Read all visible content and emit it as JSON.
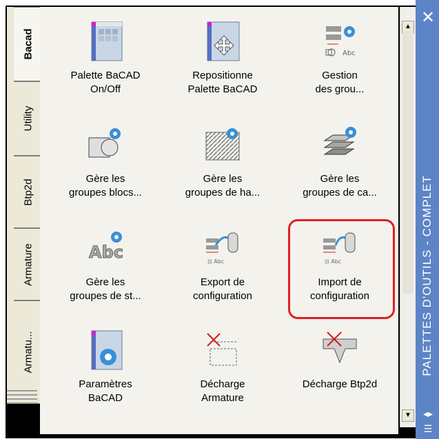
{
  "tabs": [
    {
      "label": "Bacad",
      "active": true
    },
    {
      "label": "Utility",
      "active": false
    },
    {
      "label": "Btp2d",
      "active": false
    },
    {
      "label": "Armature",
      "active": false
    },
    {
      "label": "Armatu...",
      "active": false
    }
  ],
  "tools": [
    {
      "line1": "Palette BaCAD",
      "line2": "On/Off",
      "icon": "palette-icon"
    },
    {
      "line1": "Repositionne",
      "line2": "Palette BaCAD",
      "icon": "move-palette-icon"
    },
    {
      "line1": "Gestion",
      "line2": "des grou...",
      "icon": "group-management-icon"
    },
    {
      "line1": "Gère les",
      "line2": "groupes blocs...",
      "icon": "block-groups-icon"
    },
    {
      "line1": "Gère les",
      "line2": "groupes de ha...",
      "icon": "hatch-groups-icon"
    },
    {
      "line1": "Gère les",
      "line2": "groupes de ca...",
      "icon": "layer-groups-icon"
    },
    {
      "line1": "Gère les",
      "line2": "groupes de st...",
      "icon": "style-groups-icon"
    },
    {
      "line1": "Export de",
      "line2": "configuration",
      "icon": "export-config-icon"
    },
    {
      "line1": "Import de",
      "line2": "configuration",
      "icon": "import-config-icon"
    },
    {
      "line1": "Paramètres",
      "line2": "BaCAD",
      "icon": "settings-icon"
    },
    {
      "line1": "Décharge",
      "line2": "Armature",
      "icon": "unload-armature-icon"
    },
    {
      "line1": "Décharge Btp2d",
      "line2": "",
      "icon": "unload-btp2d-icon"
    }
  ],
  "palette_title": "PALETTES D'OUTILS - COMPLET",
  "colors": {
    "titlebar": "#5d84c6",
    "highlight": "#e02020",
    "tab_bg": "#ece9d8"
  }
}
